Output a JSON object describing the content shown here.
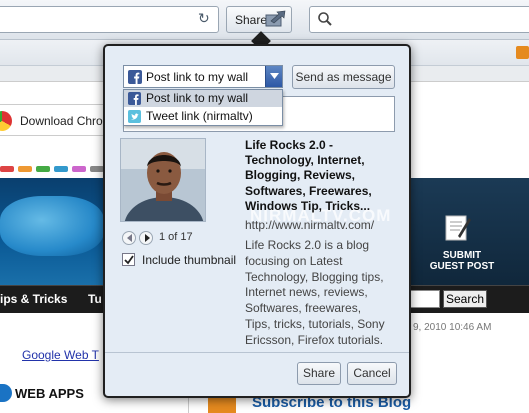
{
  "toolbar": {
    "share_label": "Share",
    "icons": [
      "reload-icon",
      "share-arrow-icon",
      "search-icon"
    ]
  },
  "background_page": {
    "download_chrome": "Download Chro",
    "nav_tips": "ips & Tricks",
    "nav_tu": "Tu",
    "search_button": "Search",
    "submit_guest_post": "SUBMIT\nGUEST POST",
    "date": "9, 2010 10:46 AM",
    "google_link": "Google Web T",
    "web_apps": "WEB APPS",
    "subscribe": "Subscribe to this Blog"
  },
  "share_popup": {
    "selected_action": "Post link to my wall",
    "send_as_message": "Send as message",
    "dropdown_options": [
      {
        "label": "Post link to my wall",
        "icon": "facebook-icon",
        "selected": true
      },
      {
        "label": "Tweet link (nirmaltv)",
        "icon": "twitter-icon",
        "selected": false
      }
    ],
    "message_value": "",
    "page_title": "Life Rocks 2.0 - Technology, Internet, Blogging, Reviews, Softwares, Freewares, Windows Tip, Tricks...",
    "page_url": "http://www.nirmaltv.com/",
    "page_description": "Life Rocks 2.0 is a blog focusing on Latest Technology, Blogging tips, Internet news, reviews, Softwares, freewares, Tips, tricks, tutorials, Sony Ericsson, Firefox tutorials.",
    "thumbnail_counter": "1 of 17",
    "include_thumbnail_label": "Include thumbnail",
    "include_thumbnail_checked": true,
    "share_button": "Share",
    "cancel_button": "Cancel",
    "watermark": "NIRMALTV.COM"
  },
  "colors": {
    "popup_bg": "#e4ecf5",
    "popup_border": "#202020",
    "facebook_blue": "#3b5998",
    "twitter_blue": "#5bc0de",
    "banner_blue": "#0b5a96"
  }
}
